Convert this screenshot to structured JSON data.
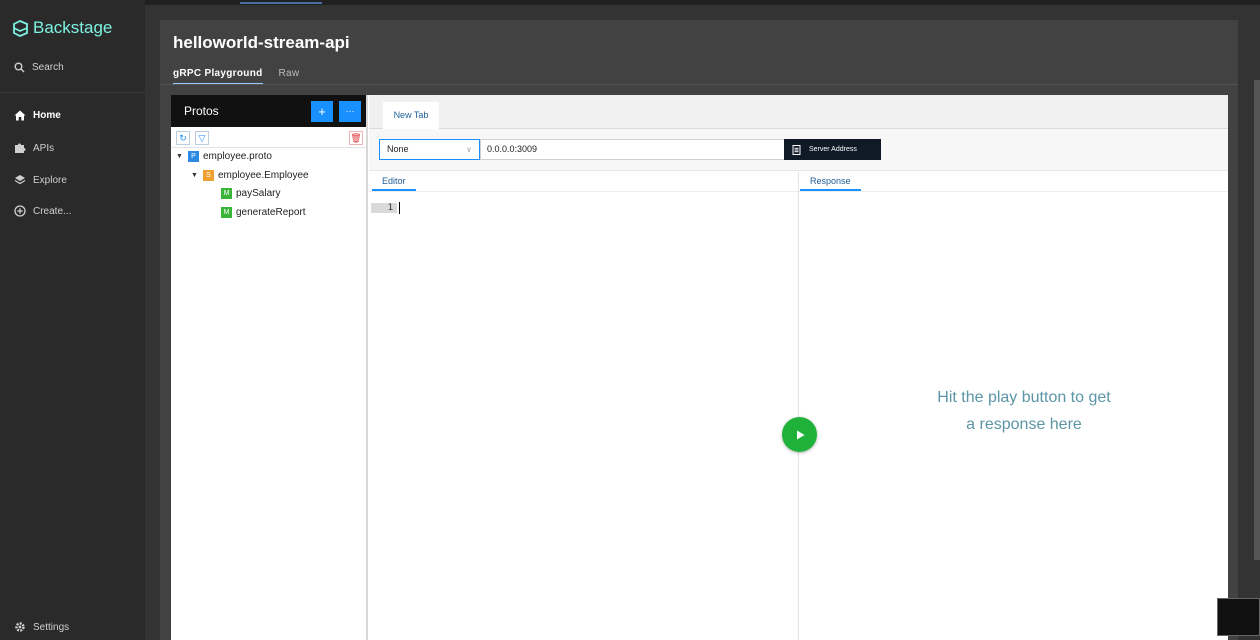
{
  "sidebar": {
    "logo_text": "Backstage",
    "search_label": "Search",
    "items": [
      {
        "label": "Home",
        "icon": "home-icon"
      },
      {
        "label": "APIs",
        "icon": "puzzle-icon"
      },
      {
        "label": "Explore",
        "icon": "layers-icon"
      },
      {
        "label": "Create...",
        "icon": "plus-circle-icon"
      }
    ],
    "settings_label": "Settings"
  },
  "page": {
    "title": "helloworld-stream-api",
    "tabs": [
      {
        "label": "gRPC Playground",
        "active": true
      },
      {
        "label": "Raw",
        "active": false
      }
    ]
  },
  "protos": {
    "title": "Protos",
    "add_label": "+",
    "more_label": "···",
    "tree": [
      {
        "badge": "P",
        "label": "employee.proto",
        "color": "#2d8ae3"
      },
      {
        "badge": "S",
        "label": "employee.Employee",
        "color": "#f0a030"
      },
      {
        "badge": "M",
        "label": "paySalary",
        "color": "#3ab53a"
      },
      {
        "badge": "M",
        "label": "generateReport",
        "color": "#3ab53a"
      }
    ]
  },
  "workspace": {
    "tab_label": "New Tab",
    "select_value": "None",
    "address_value": "0.0.0.0:3009",
    "server_button_label": "Server Address",
    "editor_tab": "Editor",
    "response_tab": "Response",
    "line_number": "1",
    "hint_line1": "Hit the play button to get",
    "hint_line2": "a response here"
  },
  "colors": {
    "accent": "#1890ff",
    "brand": "#7df3e1",
    "play": "#1fb23a"
  }
}
